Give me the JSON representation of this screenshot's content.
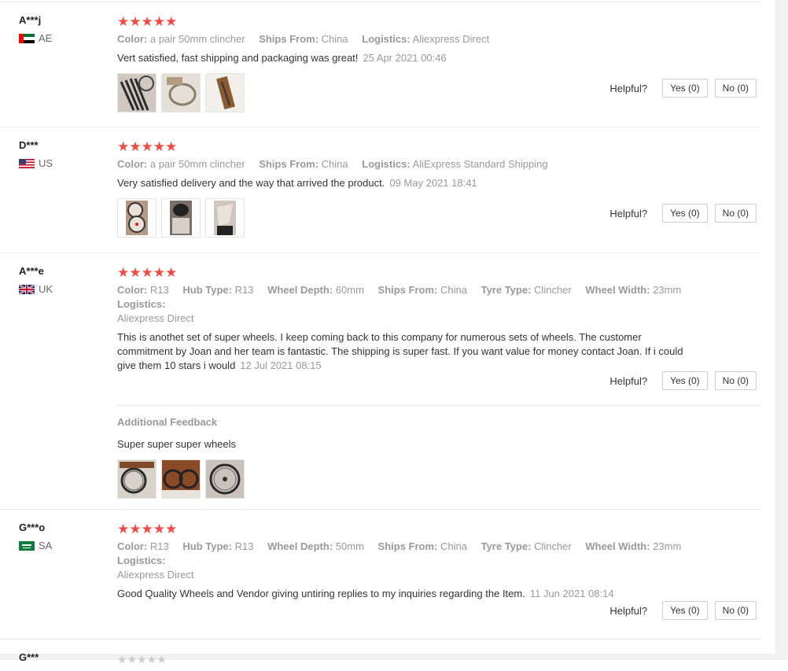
{
  "helpful_label": "Helpful?",
  "reviews": [
    {
      "user": "A***j",
      "country": "AE",
      "stars": "★★★★★",
      "props": [
        {
          "key": "Color:",
          "value": "a pair 50mm clincher"
        },
        {
          "key": "Ships From:",
          "value": "China"
        },
        {
          "key": "Logistics:",
          "value": "Aliexpress Direct"
        }
      ],
      "text": "Vert satisfied, fast shipping and packaging was great!",
      "date": "25 Apr 2021 00:46",
      "yes": "Yes (0)",
      "no": "No (0)"
    },
    {
      "user": "D***",
      "country": "US",
      "stars": "★★★★★",
      "props": [
        {
          "key": "Color:",
          "value": "a pair 50mm clincher"
        },
        {
          "key": "Ships From:",
          "value": "China"
        },
        {
          "key": "Logistics:",
          "value": "AliExpress Standard Shipping"
        }
      ],
      "text": "Very satisfied delivery and the way that arrived the product.",
      "date": "09 May 2021 18:41",
      "yes": "Yes (0)",
      "no": "No (0)"
    },
    {
      "user": "A***e",
      "country": "UK",
      "stars": "★★★★★",
      "props": [
        {
          "key": "Color:",
          "value": "R13"
        },
        {
          "key": "Hub Type:",
          "value": "R13"
        },
        {
          "key": "Wheel Depth:",
          "value": "60mm"
        },
        {
          "key": "Ships From:",
          "value": "China"
        },
        {
          "key": "Tyre Type:",
          "value": "Clincher"
        },
        {
          "key": "Wheel Width:",
          "value": "23mm"
        },
        {
          "key": "Logistics:",
          "value": "Aliexpress Direct"
        }
      ],
      "text": "This is anothet set of super wheels. I keep coming back to this company for numerous sets of wheels. The customer commitment by Joan and her team is fantastic. The shipping is super fast. If you want value for money contact Joan. If i could give them 10 stars i would",
      "date": "12 Jul 2021 08:15",
      "yes": "Yes (0)",
      "no": "No (0)",
      "additional_title": "Additional Feedback",
      "additional_text": "Super super super wheels"
    },
    {
      "user": "G***o",
      "country": "SA",
      "stars": "★★★★★",
      "props": [
        {
          "key": "Color:",
          "value": "R13"
        },
        {
          "key": "Hub Type:",
          "value": "R13"
        },
        {
          "key": "Wheel Depth:",
          "value": "50mm"
        },
        {
          "key": "Ships From:",
          "value": "China"
        },
        {
          "key": "Tyre Type:",
          "value": "Clincher"
        },
        {
          "key": "Wheel Width:",
          "value": "23mm"
        },
        {
          "key": "Logistics:",
          "value": "Aliexpress Direct"
        }
      ],
      "text": "Good Quality Wheels and Vendor giving untiring replies to my inquiries regarding the Item.",
      "date": "11 Jun 2021 08:14",
      "yes": "Yes (0)",
      "no": "No (0)"
    },
    {
      "user": "G***"
    }
  ],
  "colors": {
    "star": "#f44a44",
    "muted": "#999999",
    "border": "#e8e8e8"
  }
}
